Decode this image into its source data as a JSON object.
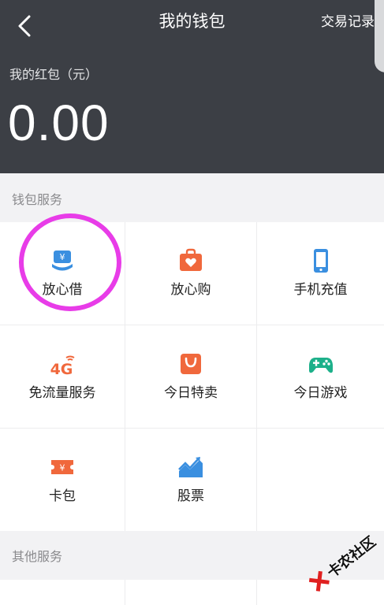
{
  "header": {
    "title": "我的钱包",
    "records_label": "交易记录",
    "redpack_label": "我的红包（元）",
    "balance": "0.00"
  },
  "sections": {
    "wallet_services": "钱包服务",
    "other_services": "其他服务"
  },
  "services": [
    {
      "label": "放心借",
      "icon": "yuan-hand-icon",
      "color": "#3a8fe0"
    },
    {
      "label": "放心购",
      "icon": "shopping-bag-heart-icon",
      "color": "#f0683c"
    },
    {
      "label": "手机充值",
      "icon": "mobile-phone-icon",
      "color": "#3a8fe0"
    },
    {
      "label": "免流量服务",
      "icon": "4g-icon",
      "color": "#f0683c"
    },
    {
      "label": "今日特卖",
      "icon": "shopping-bag-icon",
      "color": "#f0683c"
    },
    {
      "label": "今日游戏",
      "icon": "gamepad-icon",
      "color": "#1db08a"
    },
    {
      "label": "卡包",
      "icon": "coupon-yuan-icon",
      "color": "#f0683c"
    },
    {
      "label": "股票",
      "icon": "stock-chart-icon",
      "color": "#3a8fe0"
    }
  ],
  "watermark": {
    "text": "卡农社区"
  }
}
